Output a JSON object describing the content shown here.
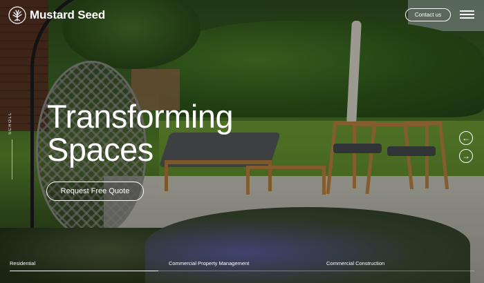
{
  "brand": {
    "name": "Mustard Seed",
    "logo_icon": "tree-icon"
  },
  "header": {
    "contact_label": "Contact us",
    "menu_icon": "hamburger-icon"
  },
  "scroll_label": "Scroll",
  "hero": {
    "title_line1": "Transforming",
    "title_line2": "Spaces",
    "cta_label": "Request Free Quote"
  },
  "slider": {
    "prev_icon": "arrow-left-icon",
    "next_icon": "arrow-right-icon",
    "prev_glyph": "←",
    "next_glyph": "→"
  },
  "bottom_nav": {
    "items": [
      {
        "label": "Residential",
        "active": true
      },
      {
        "label": "Commercial Property Management",
        "active": false
      },
      {
        "label": "Commercial Construction",
        "active": false
      }
    ]
  },
  "colors": {
    "text": "#ffffff",
    "wood": "#b8803f",
    "lawn": "#6e9d34"
  }
}
